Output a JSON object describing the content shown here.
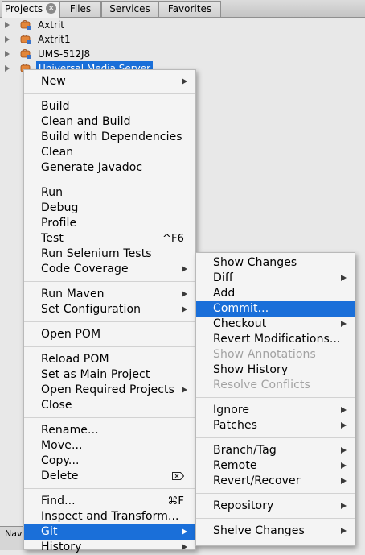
{
  "tabs": [
    {
      "label": "Projects",
      "active": true
    },
    {
      "label": "Files"
    },
    {
      "label": "Services"
    },
    {
      "label": "Favorites"
    }
  ],
  "tree": [
    {
      "label": "Axtrit"
    },
    {
      "label": "Axtrit1"
    },
    {
      "label": "UMS-512J8"
    },
    {
      "label": "Universal Media Server",
      "selected": true
    }
  ],
  "bottom_tab": {
    "label": "Nav"
  },
  "context_menu": {
    "new": "New",
    "build": "Build",
    "clean_and_build": "Clean and Build",
    "build_with_dependencies": "Build with Dependencies",
    "clean": "Clean",
    "generate_javadoc": "Generate Javadoc",
    "run": "Run",
    "debug": "Debug",
    "profile": "Profile",
    "test": "Test",
    "test_shortcut": "^F6",
    "run_selenium_tests": "Run Selenium Tests",
    "code_coverage": "Code Coverage",
    "run_maven": "Run Maven",
    "set_configuration": "Set Configuration",
    "open_pom": "Open POM",
    "reload_pom": "Reload POM",
    "set_as_main_project": "Set as Main Project",
    "open_required_projects": "Open Required Projects",
    "close": "Close",
    "rename": "Rename...",
    "move": "Move...",
    "copy": "Copy...",
    "delete": "Delete",
    "find": "Find...",
    "find_shortcut": "⌘F",
    "inspect_and_transform": "Inspect and Transform...",
    "git": "Git",
    "history": "History"
  },
  "git_submenu": {
    "show_changes": "Show Changes",
    "diff": "Diff",
    "add": "Add",
    "commit": "Commit...",
    "checkout": "Checkout",
    "revert_modifications": "Revert Modifications...",
    "show_annotations": "Show Annotations",
    "show_history": "Show History",
    "resolve_conflicts": "Resolve Conflicts",
    "ignore": "Ignore",
    "patches": "Patches",
    "branch_tag": "Branch/Tag",
    "remote": "Remote",
    "revert_recover": "Revert/Recover",
    "repository": "Repository",
    "shelve_changes": "Shelve Changes"
  },
  "colors": {
    "highlight": "#1a6fd9",
    "disabled_text": "#a2a2a2"
  }
}
